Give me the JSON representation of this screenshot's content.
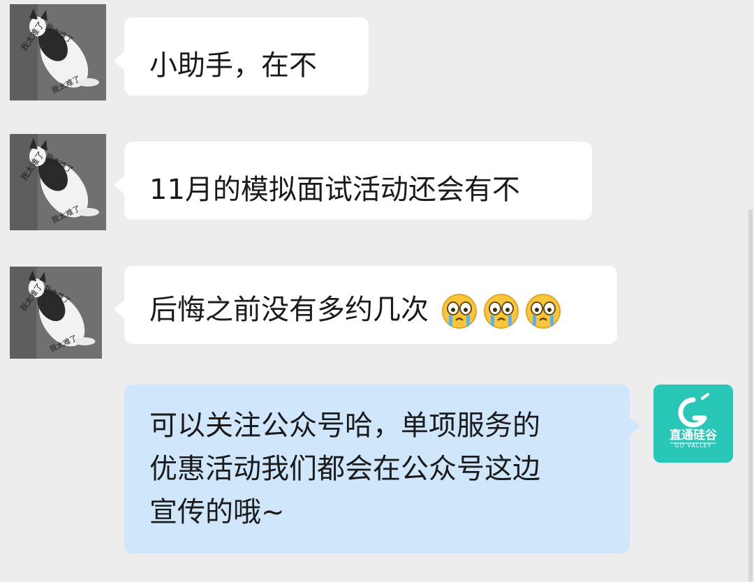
{
  "messages": [
    {
      "side": "incoming",
      "text": "小助手，在不"
    },
    {
      "side": "incoming",
      "text": "11月的模拟面试活动还会有不"
    },
    {
      "side": "incoming",
      "text": "后悔之前没有多约几次",
      "emoji": [
        "loudly-crying-face",
        "loudly-crying-face",
        "loudly-crying-face"
      ]
    },
    {
      "side": "outgoing",
      "lines": [
        "可以关注公众号哈，单项服务的",
        "优惠活动我们都会在公众号这边",
        "宣传的哦~"
      ]
    }
  ],
  "avatars": {
    "user_caption": [
      "我太难了",
      "我太难了",
      "我太难了",
      "我太难了"
    ],
    "bot_logo_text": "直通硅谷",
    "bot_logo_sub": "GO VALLEY"
  },
  "colors": {
    "background": "#ededed",
    "incoming_bubble": "#ffffff",
    "outgoing_bubble": "#cfe6fb",
    "bot_avatar": "#28c7b8"
  }
}
